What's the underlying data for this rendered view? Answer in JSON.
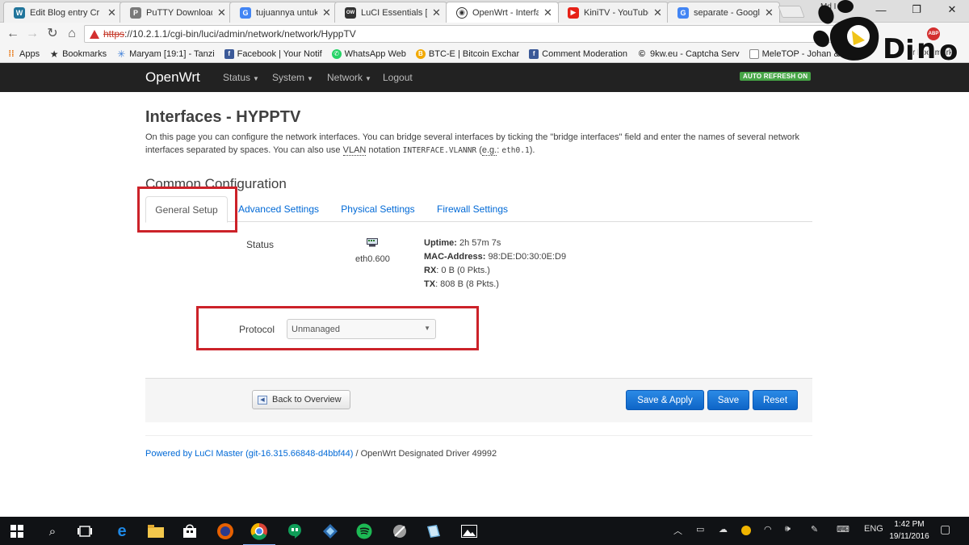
{
  "browser": {
    "tabs": [
      {
        "label": "Edit Blog entry Cr",
        "icon": "wordpress-icon"
      },
      {
        "label": "PuTTY Download",
        "icon": "putty-icon"
      },
      {
        "label": "tujuannya untuk",
        "icon": "google-icon"
      },
      {
        "label": "LuCI Essentials [C",
        "icon": "openwrt-icon"
      },
      {
        "label": "OpenWrt - Interfa",
        "icon": "openwrt-icon"
      },
      {
        "label": "KiniTV - YouTube",
        "icon": "youtube-icon"
      },
      {
        "label": "separate - Googl",
        "icon": "google-icon"
      }
    ],
    "profile_name": "Md I",
    "url_scheme": "https",
    "url_rest": "://10.2.1.1/cgi-bin/luci/admin/network/network/HyppTV",
    "bookmarks": [
      {
        "label": "Apps",
        "icon": "apps-grid-icon"
      },
      {
        "label": "Bookmarks",
        "icon": "star-icon"
      },
      {
        "label": "Maryam [19:1] - Tanzi",
        "icon": "snowflake-icon"
      },
      {
        "label": "Facebook | Your Notif",
        "icon": "facebook-icon"
      },
      {
        "label": "WhatsApp Web",
        "icon": "whatsapp-icon"
      },
      {
        "label": "BTC-E | Bitcoin Exchar",
        "icon": "btc-icon"
      },
      {
        "label": "Comment Moderation",
        "icon": "facebook-icon"
      },
      {
        "label": "9kw.eu - Captcha Serv",
        "icon": "9kw-icon"
      },
      {
        "label": "MeleTOP - Johan & A",
        "icon": "page-icon"
      }
    ],
    "other_bookmarks": "r bookmarks"
  },
  "owheader": {
    "brand": "OpenWrt",
    "menu": [
      "Status",
      "System",
      "Network",
      "Logout"
    ],
    "autorefresh": "AUTO REFRESH ON"
  },
  "page": {
    "title": "Interfaces - HYPPTV",
    "desc1": "On this page you can configure the network interfaces. You can bridge several interfaces by ticking the \"bridge interfaces\" field and enter the names of several network interfaces separated by spaces. You can also use ",
    "desc_vlan": "VLAN",
    "desc2": " notation ",
    "desc_code1": "INTERFACE.VLANNR",
    "desc3": " (",
    "desc_eg": "e.g.",
    "desc4": ": ",
    "desc_code2": "eth0.1",
    "desc5": ").",
    "section_title": "Common Configuration",
    "tabs": [
      "General Setup",
      "Advanced Settings",
      "Physical Settings",
      "Firewall Settings"
    ],
    "status_label": "Status",
    "interface_name": "eth0.600",
    "uptime_label": "Uptime:",
    "uptime_value": " 2h 57m 7s",
    "mac_label": "MAC-Address:",
    "mac_value": " 98:DE:D0:30:0E:D9",
    "rx_label": "RX",
    "rx_value": ": 0 B (0 Pkts.)",
    "tx_label": "TX",
    "tx_value": ": 808 B (8 Pkts.)",
    "protocol_label": "Protocol",
    "protocol_value": "Unmanaged",
    "back_button": "Back to Overview",
    "save_apply_button": "Save & Apply",
    "save_button": "Save",
    "reset_button": "Reset",
    "footer_link": "Powered by LuCI Master (git-16.315.66848-d4bbf44)",
    "footer_text": " / OpenWrt Designated Driver 49992"
  },
  "taskbar": {
    "language": "ENG",
    "time": "1:42 PM",
    "date": "19/11/2016"
  },
  "colors": {
    "header_bg": "#222222",
    "link_blue": "#0069d6",
    "highlight_red": "#cc2229",
    "button_blue": "#1473d7",
    "autorefresh_green": "#46a546"
  }
}
